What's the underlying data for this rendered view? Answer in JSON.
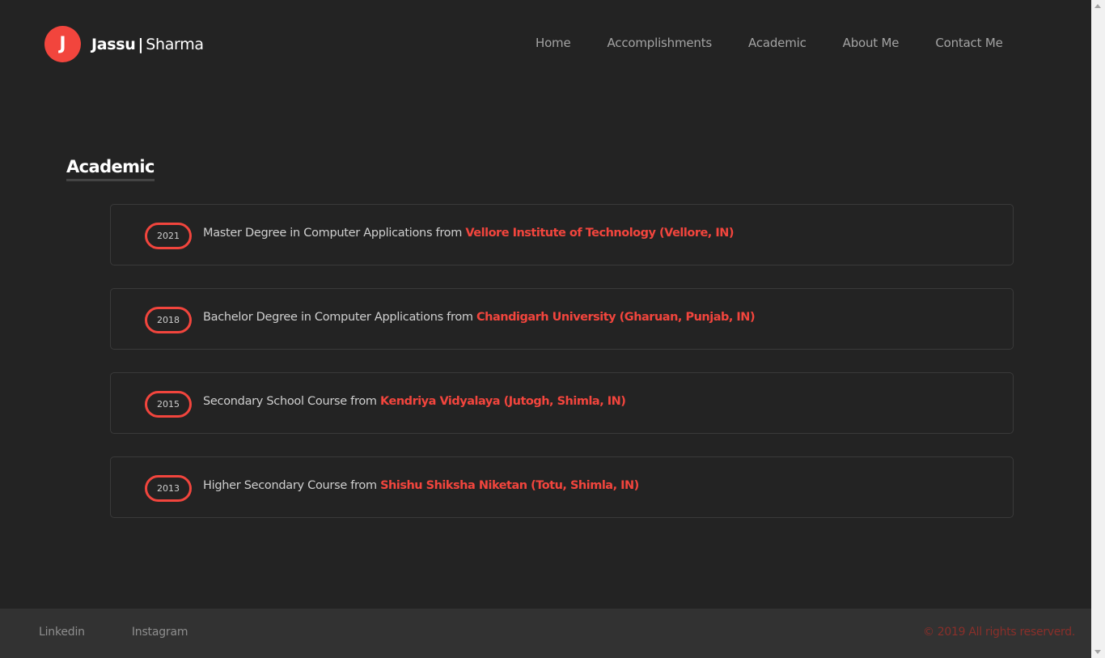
{
  "header": {
    "logo_initial": "J",
    "first_name": "Jassu",
    "separator": "|",
    "last_name": "Sharma",
    "nav": [
      {
        "label": "Home"
      },
      {
        "label": "Accomplishments"
      },
      {
        "label": "Academic"
      },
      {
        "label": "About Me"
      },
      {
        "label": "Contact Me"
      }
    ]
  },
  "section": {
    "title": "Academic"
  },
  "timeline": [
    {
      "year": "2021",
      "text": "Master Degree in Computer Applications from",
      "institution": "Vellore Institute of Technology (Vellore, IN)"
    },
    {
      "year": "2018",
      "text": "Bachelor Degree in Computer Applications from",
      "institution": "Chandigarh University (Gharuan, Punjab, IN)"
    },
    {
      "year": "2015",
      "text": "Secondary School Course from",
      "institution": "Kendriya Vidyalaya (Jutogh, Shimla, IN)"
    },
    {
      "year": "2013",
      "text": "Higher Secondary Course from",
      "institution": "Shishu Shiksha Niketan (Totu, Shimla, IN)"
    }
  ],
  "footer": {
    "links": [
      {
        "label": "Linkedin"
      },
      {
        "label": "Instagram"
      }
    ],
    "copyright": "© 2019  All rights reserverd."
  },
  "colors": {
    "accent": "#f2453d",
    "background": "#232323",
    "footer_background": "#323232"
  }
}
